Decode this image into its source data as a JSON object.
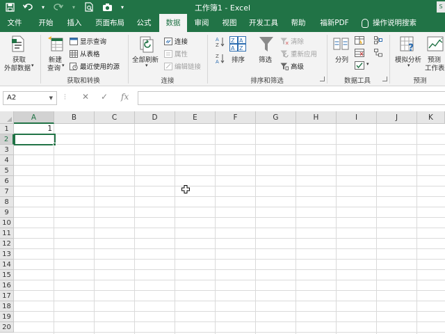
{
  "window": {
    "title": "工作簿1 - Excel",
    "user_badge": "S"
  },
  "tabs": [
    {
      "label": "文件"
    },
    {
      "label": "开始"
    },
    {
      "label": "插入"
    },
    {
      "label": "页面布局"
    },
    {
      "label": "公式"
    },
    {
      "label": "数据"
    },
    {
      "label": "审阅"
    },
    {
      "label": "视图"
    },
    {
      "label": "开发工具"
    },
    {
      "label": "帮助"
    },
    {
      "label": "福新PDF"
    },
    {
      "label": "操作说明搜索"
    }
  ],
  "ribbon": {
    "get_external_data_line1": "获取",
    "get_external_data_line2": "外部数据",
    "new_query_line1": "新建",
    "new_query_line2": "查询",
    "show_queries": "显示查询",
    "from_table": "从表格",
    "recent_sources": "最近使用的源",
    "group_get_transform": "获取和转换",
    "refresh_all": "全部刷新",
    "connections": "连接",
    "properties": "属性",
    "edit_links": "编辑链接",
    "group_connections": "连接",
    "sort": "排序",
    "filter": "筛选",
    "clear": "清除",
    "reapply": "重新应用",
    "advanced": "高级",
    "group_sort_filter": "排序和筛选",
    "text_to_columns": "分列",
    "group_data_tools": "数据工具",
    "what_if_line1": "模拟分析",
    "forecast_line1": "预测",
    "forecast_line2": "工作表",
    "group_forecast": "预测"
  },
  "formula_bar": {
    "name_box": "A2",
    "formula": ""
  },
  "grid": {
    "columns": [
      "A",
      "B",
      "C",
      "D",
      "E",
      "F",
      "G",
      "H",
      "I",
      "J",
      "K"
    ],
    "rows": [
      "1",
      "2",
      "3",
      "4",
      "5",
      "6",
      "7",
      "8",
      "9",
      "10",
      "11",
      "12",
      "13",
      "14",
      "15",
      "16",
      "17",
      "18",
      "19",
      "20"
    ],
    "cell_A1": "1",
    "selected_column": "A",
    "selected_row": "2"
  },
  "colors": {
    "accent": "#217346",
    "ribbon_bg": "#f3f3f3",
    "header_bg": "#e6e6e6"
  }
}
